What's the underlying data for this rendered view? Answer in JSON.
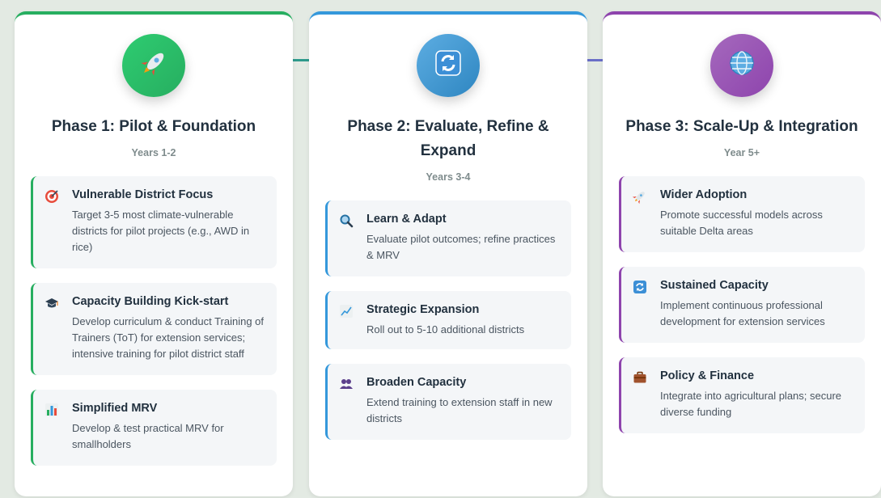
{
  "colors": {
    "phase1": "#27ae60",
    "phase2": "#3498db",
    "phase3": "#8e44ad"
  },
  "phases": [
    {
      "title": "Phase 1: Pilot & Foundation",
      "years": "Years 1-2",
      "icon": "rocket-icon",
      "items": [
        {
          "icon": "target-icon",
          "title": "Vulnerable District Focus",
          "desc": "Target 3-5 most climate-vulnerable districts for pilot projects (e.g., AWD in rice)"
        },
        {
          "icon": "graduation-cap-icon",
          "title": "Capacity Building Kick-start",
          "desc": "Develop curriculum & conduct Training of Trainers (ToT) for extension services; intensive training for pilot district staff"
        },
        {
          "icon": "bar-chart-icon",
          "title": "Simplified MRV",
          "desc": "Develop & test practical MRV for smallholders"
        }
      ]
    },
    {
      "title": "Phase 2: Evaluate, Refine & Expand",
      "years": "Years 3-4",
      "icon": "refresh-icon",
      "items": [
        {
          "icon": "magnifier-icon",
          "title": "Learn & Adapt",
          "desc": "Evaluate pilot outcomes; refine practices & MRV"
        },
        {
          "icon": "trend-chart-icon",
          "title": "Strategic Expansion",
          "desc": "Roll out to 5-10 additional districts"
        },
        {
          "icon": "people-icon",
          "title": "Broaden Capacity",
          "desc": "Extend training to extension staff in new districts"
        }
      ]
    },
    {
      "title": "Phase 3: Scale-Up & Integration",
      "years": "Year 5+",
      "icon": "globe-icon",
      "items": [
        {
          "icon": "rocket-icon",
          "title": "Wider Adoption",
          "desc": "Promote successful models across suitable Delta areas"
        },
        {
          "icon": "refresh-icon",
          "title": "Sustained Capacity",
          "desc": "Implement continuous professional development for extension services"
        },
        {
          "icon": "briefcase-icon",
          "title": "Policy & Finance",
          "desc": "Integrate into agricultural plans; secure diverse funding"
        }
      ]
    }
  ]
}
